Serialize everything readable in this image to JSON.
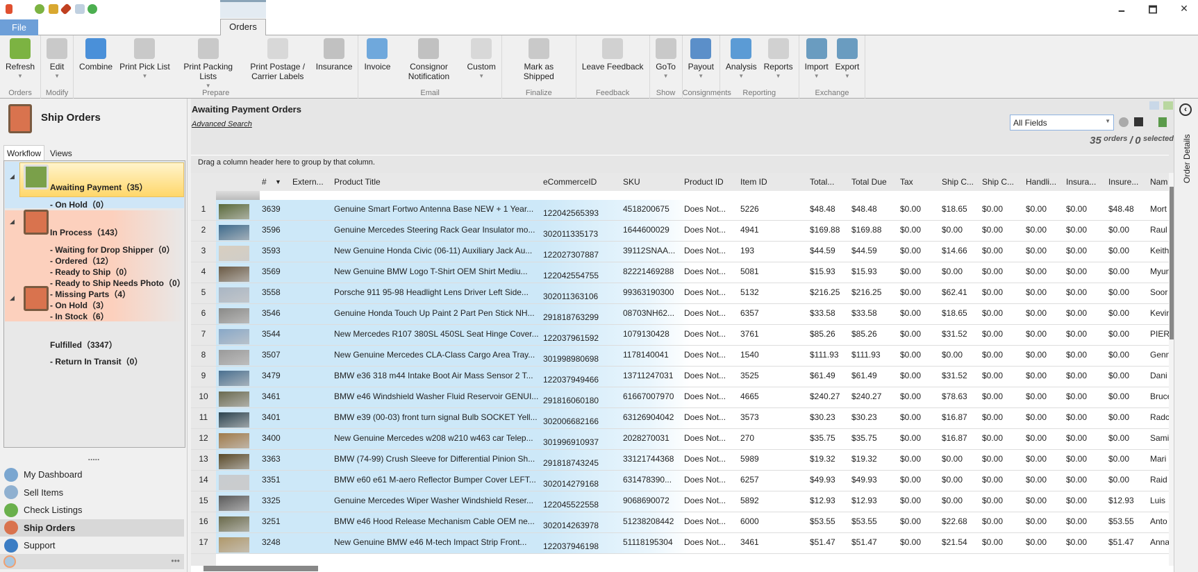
{
  "window": {
    "minimize": "🗕",
    "maximize": "🗖",
    "close": "✕"
  },
  "tabs": {
    "file": "File",
    "orders": "Orders"
  },
  "ribbon": [
    {
      "group": "Orders",
      "buttons": [
        {
          "label": "Refresh",
          "caret": true,
          "icon": "refresh-icon",
          "color": "#7cb342",
          "dim": false
        }
      ]
    },
    {
      "group": "Modify",
      "buttons": [
        {
          "label": "Edit",
          "caret": true,
          "icon": "edit-icon",
          "color": "#999999",
          "dim": true
        }
      ]
    },
    {
      "group": "Prepare",
      "buttons": [
        {
          "label": "Combine",
          "icon": "combine-icon",
          "color": "#4a90d9",
          "dim": false
        },
        {
          "label": "Print Pick List",
          "caret": true,
          "icon": "basket-icon",
          "color": "#999999",
          "dim": true
        },
        {
          "label": "Print Packing Lists",
          "caret": true,
          "icon": "checklist-icon",
          "color": "#999999",
          "dim": true
        },
        {
          "label": "Print Postage / Carrier Labels",
          "icon": "envelope-icon",
          "color": "#bbbbbb",
          "dim": true
        },
        {
          "label": "Insurance",
          "icon": "umbrella-icon",
          "color": "#888888",
          "dim": true
        }
      ]
    },
    {
      "group": "Email",
      "buttons": [
        {
          "label": "Invoice",
          "icon": "invoice-icon",
          "color": "#6fa8dc",
          "dim": false
        },
        {
          "label": "Consignor Notification",
          "icon": "consignor-icon",
          "color": "#888888",
          "dim": true
        },
        {
          "label": "Custom",
          "caret": true,
          "icon": "mail-icon",
          "color": "#bbbbbb",
          "dim": true
        }
      ]
    },
    {
      "group": "Finalize",
      "buttons": [
        {
          "label": "Mark as Shipped",
          "icon": "truck-icon",
          "color": "#999999",
          "dim": true
        }
      ]
    },
    {
      "group": "Feedback",
      "buttons": [
        {
          "label": "Leave Feedback",
          "icon": "star-icon",
          "color": "#aaaaaa",
          "dim": true
        }
      ]
    },
    {
      "group": "Show",
      "buttons": [
        {
          "label": "GoTo",
          "caret": true,
          "icon": "chain-link-icon",
          "color": "#999999",
          "dim": true
        }
      ]
    },
    {
      "group": "Consignments",
      "buttons": [
        {
          "label": "Payout",
          "caret": true,
          "icon": "payout-icon",
          "color": "#5b8fc9",
          "dim": false
        }
      ]
    },
    {
      "group": "Reporting",
      "buttons": [
        {
          "label": "Analysis",
          "caret": true,
          "icon": "line-chart-icon",
          "color": "#5b9bd5",
          "dim": false
        },
        {
          "label": "Reports",
          "caret": true,
          "icon": "reports-icon",
          "color": "#aaaaaa",
          "dim": true
        }
      ]
    },
    {
      "group": "Exchange",
      "buttons": [
        {
          "label": "Import",
          "caret": true,
          "icon": "database-import-icon",
          "color": "#6a9cc0",
          "dim": false
        },
        {
          "label": "Export",
          "caret": true,
          "icon": "database-export-icon",
          "color": "#6a9cc0",
          "dim": false
        }
      ]
    }
  ],
  "left": {
    "title": "Ship Orders",
    "tabs": [
      "Workflow",
      "Views"
    ],
    "tree": [
      {
        "label": "Awaiting Payment（35）",
        "top": true
      },
      {
        "label": "- On Hold（0）"
      },
      {
        "label": "In Process（143）",
        "top": true
      },
      {
        "label": "- Waiting for Drop Shipper（0）"
      },
      {
        "label": "- Ordered（12）"
      },
      {
        "label": "- Ready to Ship（0）"
      },
      {
        "label": "- Ready to Ship Needs Photo（0）"
      },
      {
        "label": "- Missing Parts（4）"
      },
      {
        "label": "- On Hold（3）"
      },
      {
        "label": "- In Stock（6）"
      },
      {
        "label": "Fulfilled（3347）",
        "top": true
      },
      {
        "label": "- Return In Transit（0）"
      }
    ],
    "divider": ".....",
    "nav": [
      {
        "label": "My Dashboard",
        "icon": "dashboard-icon",
        "color": "#7aa6d0"
      },
      {
        "label": "Sell Items",
        "icon": "sell-items-icon",
        "color": "#8fb0d0"
      },
      {
        "label": "Check Listings",
        "icon": "check-listings-icon",
        "color": "#6ab04c"
      },
      {
        "label": "Ship Orders",
        "icon": "ship-orders-icon",
        "color": "#d9734e",
        "selected": true
      },
      {
        "label": "Support",
        "icon": "support-icon",
        "color": "#3b7dc4"
      }
    ],
    "more": "•••"
  },
  "main": {
    "title": "Awaiting Payment Orders",
    "advanced_search": "Advanced Search",
    "search_field": "All Fields",
    "count": "35",
    "count_label": "orders",
    "sep": "/",
    "selected": "0",
    "selected_label": "selected",
    "group_hint": "Drag a column header here to group by that column.",
    "columns": [
      "#",
      "Extern...",
      "Product Title",
      "eCommerceID",
      "SKU",
      "Product ID",
      "Item ID",
      "Total...",
      "Total Due",
      "Tax",
      "Ship C...",
      "Ship C...",
      "Handli...",
      "Insura...",
      "Insure...",
      "Nam"
    ],
    "rows": [
      [
        "1",
        "#5a6a3a",
        "3639",
        "",
        "Genuine Smart Fortwo Antenna Base NEW + 1 Year...",
        "122042565393",
        "4518200675",
        "Does Not...",
        "5226",
        "$48.48",
        "$48.48",
        "$0.00",
        "$18.65",
        "$0.00",
        "$0.00",
        "$0.00",
        "$48.48",
        "Mort"
      ],
      [
        "2",
        "#3d6a8c",
        "3596",
        "",
        "Genuine Mercedes Steering Rack Gear Insulator mo...",
        "302011335173",
        "1644600029",
        "Does Not...",
        "4941",
        "$169.88",
        "$169.88",
        "$0.00",
        "$0.00",
        "$0.00",
        "$0.00",
        "$0.00",
        "$0.00",
        "Raul"
      ],
      [
        "3",
        "#d8cfc0",
        "3593",
        "",
        "New Genuine Honda Civic (06-11) Auxiliary Jack Au...",
        "122027307887",
        "39112SNAA...",
        "Does Not...",
        "193",
        "$44.59",
        "$44.59",
        "$0.00",
        "$14.66",
        "$0.00",
        "$0.00",
        "$0.00",
        "$0.00",
        "Keith"
      ],
      [
        "4",
        "#6b5a44",
        "3569",
        "",
        "New Genuine BMW Logo T-Shirt OEM Shirt Mediu...",
        "122042554755",
        "82221469288",
        "Does Not...",
        "5081",
        "$15.93",
        "$15.93",
        "$0.00",
        "$0.00",
        "$0.00",
        "$0.00",
        "$0.00",
        "$0.00",
        "Myun"
      ],
      [
        "5",
        "#a9b6c4",
        "3558",
        "",
        "Porsche 911 95-98 Headlight Lens Driver Left Side...",
        "302011363106",
        "99363190300",
        "Does Not...",
        "5132",
        "$216.25",
        "$216.25",
        "$0.00",
        "$62.41",
        "$0.00",
        "$0.00",
        "$0.00",
        "$0.00",
        "Soor"
      ],
      [
        "6",
        "#8a8a88",
        "3546",
        "",
        "Genuine Honda Touch Up Paint 2 Part Pen Stick NH...",
        "291818763299",
        "08703NH62...",
        "Does Not...",
        "6357",
        "$33.58",
        "$33.58",
        "$0.00",
        "$18.65",
        "$0.00",
        "$0.00",
        "$0.00",
        "$0.00",
        "Kevin"
      ],
      [
        "7",
        "#88a8c8",
        "3544",
        "",
        "New Mercedes R107 380SL 450SL Seat Hinge Cover...",
        "122037961592",
        "1079130428",
        "Does Not...",
        "3761",
        "$85.26",
        "$85.26",
        "$0.00",
        "$31.52",
        "$0.00",
        "$0.00",
        "$0.00",
        "$0.00",
        "PIERI"
      ],
      [
        "8",
        "#9a9a9a",
        "3507",
        "",
        "New Genuine Mercedes CLA-Class Cargo Area Tray...",
        "301998980698",
        "1178140041",
        "Does Not...",
        "1540",
        "$111.93",
        "$111.93",
        "$0.00",
        "$0.00",
        "$0.00",
        "$0.00",
        "$0.00",
        "$0.00",
        "Genn"
      ],
      [
        "9",
        "#4a7090",
        "3479",
        "",
        "BMW e36 318 m44 Intake Boot Air Mass Sensor 2 T...",
        "122037949466",
        "13711247031",
        "Does Not...",
        "3525",
        "$61.49",
        "$61.49",
        "$0.00",
        "$31.52",
        "$0.00",
        "$0.00",
        "$0.00",
        "$0.00",
        "Dani"
      ],
      [
        "10",
        "#6a6a50",
        "3461",
        "",
        "BMW e46 Windshield Washer Fluid Reservoir GENUI...",
        "291816060180",
        "61667007970",
        "Does Not...",
        "4665",
        "$240.27",
        "$240.27",
        "$0.00",
        "$78.63",
        "$0.00",
        "$0.00",
        "$0.00",
        "$0.00",
        "Bruce"
      ],
      [
        "11",
        "#2c4450",
        "3401",
        "",
        "BMW e39 (00-03) front turn signal Bulb SOCKET Yell...",
        "302006682166",
        "63126904042",
        "Does Not...",
        "3573",
        "$30.23",
        "$30.23",
        "$0.00",
        "$16.87",
        "$0.00",
        "$0.00",
        "$0.00",
        "$0.00",
        "Radc"
      ],
      [
        "12",
        "#a07a4a",
        "3400",
        "",
        "New Genuine Mercedes w208 w210 w463 car Telep...",
        "301996910937",
        "2028270031",
        "Does Not...",
        "270",
        "$35.75",
        "$35.75",
        "$0.00",
        "$16.87",
        "$0.00",
        "$0.00",
        "$0.00",
        "$0.00",
        "Sami"
      ],
      [
        "13",
        "#5a4a28",
        "3363",
        "",
        "BMW (74-99) Crush Sleeve for Differential Pinion Sh...",
        "291818743245",
        "33121744368",
        "Does Not...",
        "5989",
        "$19.32",
        "$19.32",
        "$0.00",
        "$0.00",
        "$0.00",
        "$0.00",
        "$0.00",
        "$0.00",
        "Mari"
      ],
      [
        "14",
        "#c8ccd0",
        "3351",
        "",
        "BMW e60 e61 M-aero Reflector Bumper Cover LEFT...",
        "302014279168",
        "631478390...",
        "Does Not...",
        "6257",
        "$49.93",
        "$49.93",
        "$0.00",
        "$0.00",
        "$0.00",
        "$0.00",
        "$0.00",
        "$0.00",
        "Raid"
      ],
      [
        "15",
        "#5a5a5a",
        "3325",
        "",
        "Genuine Mercedes Wiper Washer Windshield Reser...",
        "122045522558",
        "9068690072",
        "Does Not...",
        "5892",
        "$12.93",
        "$12.93",
        "$0.00",
        "$0.00",
        "$0.00",
        "$0.00",
        "$0.00",
        "$12.93",
        "Luis"
      ],
      [
        "16",
        "#6a6a4a",
        "3251",
        "",
        "BMW e46 Hood Release Mechanism Cable OEM ne...",
        "302014263978",
        "51238208442",
        "Does Not...",
        "6000",
        "$53.55",
        "$53.55",
        "$0.00",
        "$22.68",
        "$0.00",
        "$0.00",
        "$0.00",
        "$53.55",
        "Anto"
      ],
      [
        "17",
        "#b0986a",
        "3248",
        "",
        "New Genuine BMW e46 M-tech Impact Strip Front...",
        "122037946198",
        "51118195304",
        "Does Not...",
        "3461",
        "$51.47",
        "$51.47",
        "$0.00",
        "$21.54",
        "$0.00",
        "$0.00",
        "$0.00",
        "$51.47",
        "Anna"
      ]
    ]
  },
  "right": {
    "label": "Order Details",
    "collapse": "‹"
  },
  "colors": {
    "row_highlight": "#cde8f8",
    "awaiting_bg": "#ffd76a",
    "in_process_bg": "#fcd5c5",
    "file_tab": "#6d9fd8"
  }
}
